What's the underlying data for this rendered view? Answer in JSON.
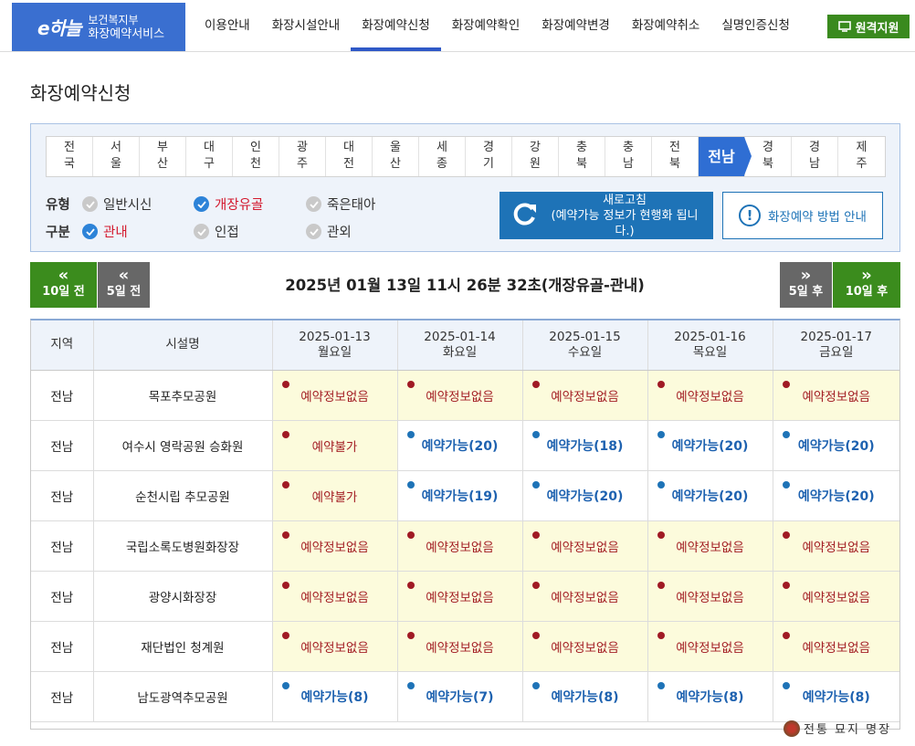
{
  "header": {
    "logo_mark": "e하늘",
    "logo_line1": "보건복지부",
    "logo_line2": "화장예약서비스",
    "nav": [
      "이용안내",
      "화장시설안내",
      "화장예약신청",
      "화장예약확인",
      "화장예약변경",
      "화장예약취소",
      "실명인증신청"
    ],
    "active_nav": 2,
    "remote_label": "원격지원",
    "accent": "#2f59c7"
  },
  "page_title": "화장예약신청",
  "regions": [
    "전국",
    "서울",
    "부산",
    "대구",
    "인천",
    "광주",
    "대전",
    "울산",
    "세종",
    "경기",
    "강원",
    "충북",
    "충남",
    "전북",
    "전남",
    "경북",
    "경남",
    "제주"
  ],
  "active_region": "전남",
  "options": {
    "type_label": "유형",
    "type_options": [
      {
        "label": "일반시신",
        "checked": false
      },
      {
        "label": "개장유골",
        "checked": true
      },
      {
        "label": "죽은태아",
        "checked": false
      }
    ],
    "area_label": "구분",
    "area_options": [
      {
        "label": "관내",
        "checked": true
      },
      {
        "label": "인접",
        "checked": false
      },
      {
        "label": "관외",
        "checked": false
      }
    ]
  },
  "refresh": {
    "line1": "새로고침",
    "line2": "(예약가능 정보가 현행화 됩니다.)"
  },
  "guide": {
    "label": "화장예약 방법 안내"
  },
  "date_nav": {
    "prev10": "10일 전",
    "prev5": "5일 전",
    "next5": "5일 후",
    "next10": "10일 후",
    "prev_arrow": "«",
    "next_arrow": "»",
    "current": "2025년 01월 13일 11시 26분 32초(개장유골-관내)"
  },
  "table": {
    "col_region": "지역",
    "col_facility": "시설명",
    "dates": [
      {
        "date": "2025-01-13",
        "day": "월요일"
      },
      {
        "date": "2025-01-14",
        "day": "화요일"
      },
      {
        "date": "2025-01-15",
        "day": "수요일"
      },
      {
        "date": "2025-01-16",
        "day": "목요일"
      },
      {
        "date": "2025-01-17",
        "day": "금요일"
      }
    ],
    "rows": [
      {
        "region": "전남",
        "facility": "목포추모공원",
        "cells": [
          [
            "none",
            "예약정보없음"
          ],
          [
            "none",
            "예약정보없음"
          ],
          [
            "none",
            "예약정보없음"
          ],
          [
            "none",
            "예약정보없음"
          ],
          [
            "none",
            "예약정보없음"
          ]
        ]
      },
      {
        "region": "전남",
        "facility": "여수시 영락공원 승화원",
        "cells": [
          [
            "none",
            "예약불가"
          ],
          [
            "ok",
            "예약가능(20)"
          ],
          [
            "ok",
            "예약가능(18)"
          ],
          [
            "ok",
            "예약가능(20)"
          ],
          [
            "ok",
            "예약가능(20)"
          ]
        ]
      },
      {
        "region": "전남",
        "facility": "순천시립 추모공원",
        "cells": [
          [
            "none",
            "예약불가"
          ],
          [
            "ok",
            "예약가능(19)"
          ],
          [
            "ok",
            "예약가능(20)"
          ],
          [
            "ok",
            "예약가능(20)"
          ],
          [
            "ok",
            "예약가능(20)"
          ]
        ]
      },
      {
        "region": "전남",
        "facility": "국립소록도병원화장장",
        "cells": [
          [
            "none",
            "예약정보없음"
          ],
          [
            "none",
            "예약정보없음"
          ],
          [
            "none",
            "예약정보없음"
          ],
          [
            "none",
            "예약정보없음"
          ],
          [
            "none",
            "예약정보없음"
          ]
        ]
      },
      {
        "region": "전남",
        "facility": "광양시화장장",
        "cells": [
          [
            "none",
            "예약정보없음"
          ],
          [
            "none",
            "예약정보없음"
          ],
          [
            "none",
            "예약정보없음"
          ],
          [
            "none",
            "예약정보없음"
          ],
          [
            "none",
            "예약정보없음"
          ]
        ]
      },
      {
        "region": "전남",
        "facility": "재단법인 청계원",
        "cells": [
          [
            "none",
            "예약정보없음"
          ],
          [
            "none",
            "예약정보없음"
          ],
          [
            "none",
            "예약정보없음"
          ],
          [
            "none",
            "예약정보없음"
          ],
          [
            "none",
            "예약정보없음"
          ]
        ]
      },
      {
        "region": "전남",
        "facility": "남도광역추모공원",
        "cells": [
          [
            "ok",
            "예약가능(8)"
          ],
          [
            "ok",
            "예약가능(7)"
          ],
          [
            "ok",
            "예약가능(8)"
          ],
          [
            "ok",
            "예약가능(8)"
          ],
          [
            "ok",
            "예약가능(8)"
          ]
        ]
      }
    ]
  },
  "watermark": "전통 묘지 명장"
}
